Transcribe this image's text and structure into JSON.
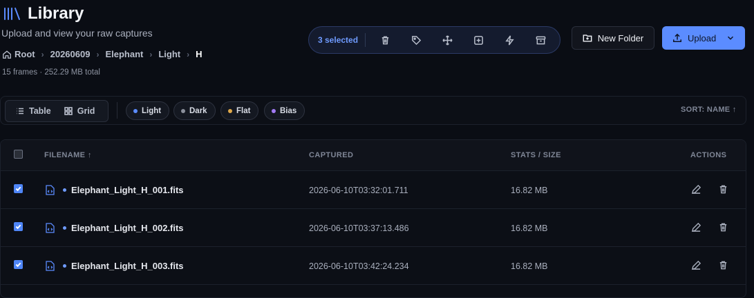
{
  "header": {
    "title": "Library",
    "subtitle": "Upload and view your raw captures",
    "meta": "15 frames · 252.29 MB total"
  },
  "breadcrumb": [
    "Root",
    "20260609",
    "Elephant",
    "Light",
    "H"
  ],
  "selection": {
    "count_label": "3 selected",
    "actions": [
      "trash-icon",
      "tag-icon",
      "move-icon",
      "plus-square-icon",
      "zap-icon",
      "archive-icon"
    ]
  },
  "buttons": {
    "new_folder": "New Folder",
    "upload": "Upload"
  },
  "toolbar": {
    "view_table": "Table",
    "view_grid": "Grid",
    "chips": [
      {
        "label": "Light",
        "color": "#5b8cff"
      },
      {
        "label": "Dark",
        "color": "#8b909c"
      },
      {
        "label": "Flat",
        "color": "#e0a94a"
      },
      {
        "label": "Bias",
        "color": "#a37bf5"
      }
    ],
    "sort": "SORT: NAME ↑"
  },
  "table": {
    "headers": {
      "filename": "FILENAME ↑",
      "captured": "CAPTURED",
      "stats": "STATS / SIZE",
      "actions": "ACTIONS"
    },
    "rows": [
      {
        "filename": "Elephant_Light_H_001.fits",
        "captured": "2026-06-10T03:32:01.711",
        "size": "16.82 MB",
        "selected": true
      },
      {
        "filename": "Elephant_Light_H_002.fits",
        "captured": "2026-06-10T03:37:13.486",
        "size": "16.82 MB",
        "selected": true
      },
      {
        "filename": "Elephant_Light_H_003.fits",
        "captured": "2026-06-10T03:42:24.234",
        "size": "16.82 MB",
        "selected": true
      }
    ]
  },
  "colors": {
    "accent": "#5b8cff",
    "background": "#0a0d14"
  }
}
